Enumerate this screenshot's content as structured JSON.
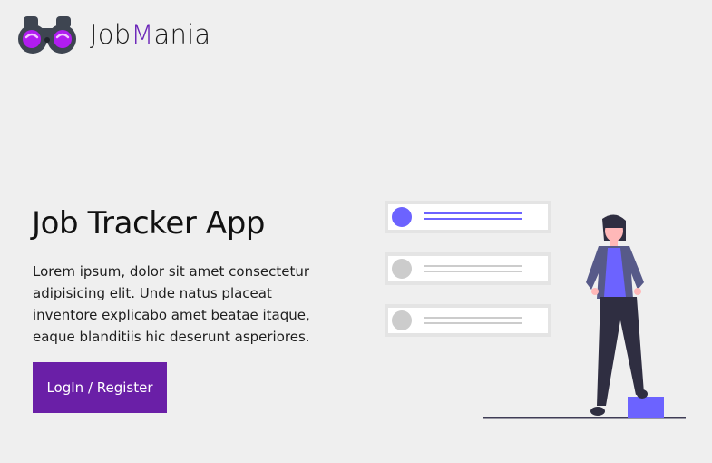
{
  "header": {
    "brand_prefix": "Job",
    "brand_accent": "M",
    "brand_suffix": "ania"
  },
  "hero": {
    "title": "Job Tracker App",
    "description": "Lorem ipsum, dolor sit amet consectetur adipisicing elit. Unde natus placeat inventore explicabo amet beatae itaque, eaque blanditiis hic deserunt asperiores.",
    "button_label": "LogIn / Register"
  },
  "icons": {
    "logo": "binoculars-icon",
    "illustration": "person-checklist-illustration"
  },
  "colors": {
    "background": "#efefef",
    "accent": "#6a1fa7",
    "illustration_primary": "#6c63ff"
  }
}
